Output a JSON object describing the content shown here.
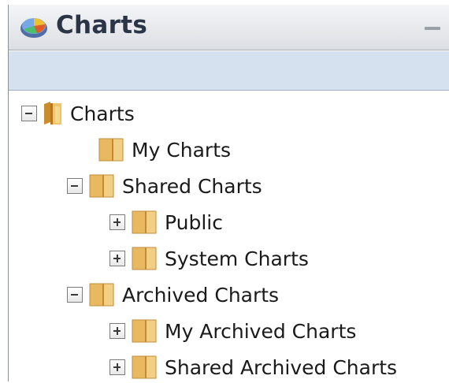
{
  "window": {
    "title": "Charts"
  },
  "tree": {
    "items": [
      {
        "label": "Charts",
        "expanded": true
      },
      {
        "label": "My Charts"
      },
      {
        "label": "Shared Charts",
        "expanded": true
      },
      {
        "label": "Public",
        "expanded": false
      },
      {
        "label": "System Charts",
        "expanded": false
      },
      {
        "label": "Archived Charts",
        "expanded": true
      },
      {
        "label": "My Archived Charts",
        "expanded": false
      },
      {
        "label": "Shared Archived Charts",
        "expanded": false
      }
    ]
  },
  "icons": {
    "title": "charts-app-icon",
    "folder": "folder-icon",
    "collapse": "collapse-minus-icon",
    "expand": "expand-plus-icon"
  },
  "colors": {
    "titlebar": "#e6e8ec",
    "toolbar": "#d6e1ef",
    "folder": "#e8b860"
  }
}
